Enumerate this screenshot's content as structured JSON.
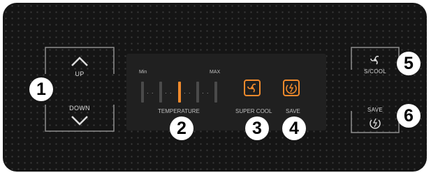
{
  "left_controls": {
    "up_label": "UP",
    "down_label": "DOWN"
  },
  "display": {
    "min_label": "Min",
    "max_label": "MAX",
    "temperature_label": "TEMPERATURE",
    "super_cool_label": "SUPER COOL",
    "save_label": "SAVE"
  },
  "right_controls": {
    "scool_label": "S/COOL",
    "save_label": "SAVE"
  },
  "callouts": [
    "1",
    "2",
    "3",
    "4",
    "5",
    "6"
  ],
  "colors": {
    "accent": "#f08a2c",
    "panel": "#151515"
  }
}
